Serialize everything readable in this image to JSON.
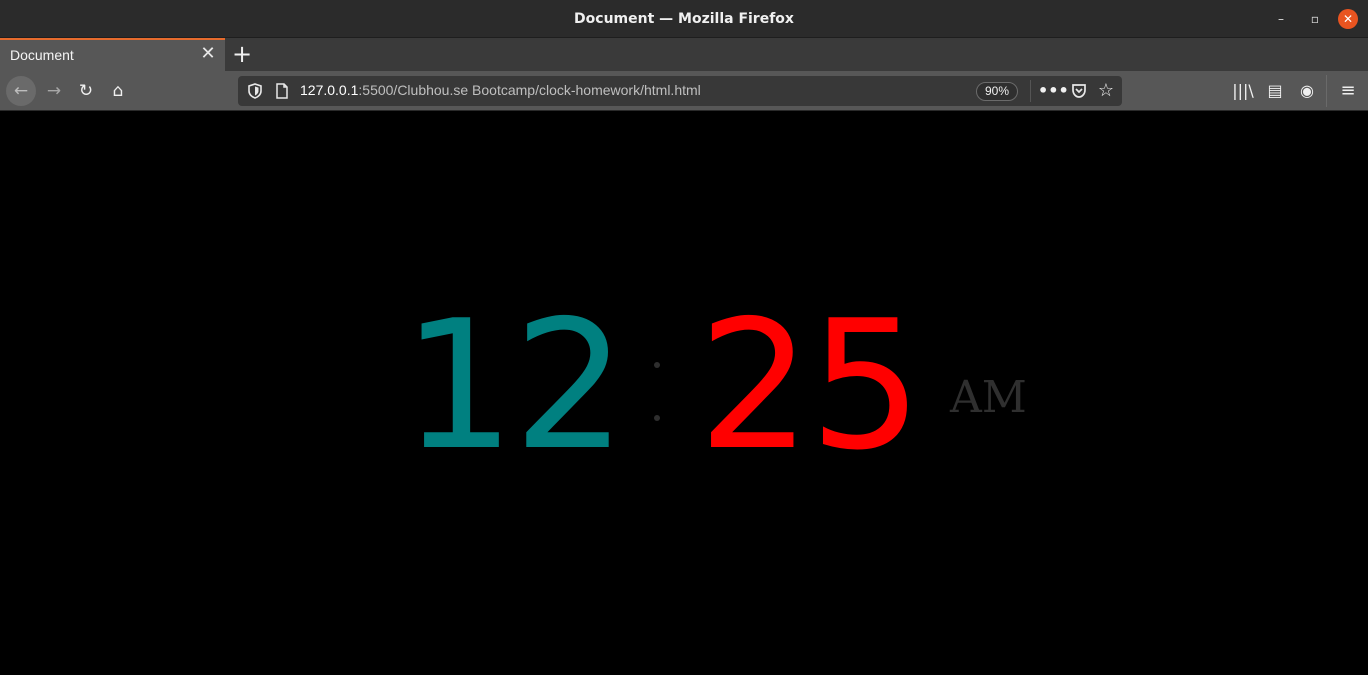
{
  "window": {
    "title": "Document — Mozilla Firefox",
    "minimize_glyph": "–",
    "maximize_glyph": "▫",
    "close_glyph": "✕"
  },
  "tabs": [
    {
      "label": "Document",
      "active": true,
      "close_glyph": "✕"
    }
  ],
  "tabstrip": {
    "new_tab_glyph": "+"
  },
  "navbar": {
    "back_glyph": "←",
    "forward_glyph": "→",
    "reload_glyph": "↻",
    "home_glyph": "⌂",
    "url_host": "127.0.0.1",
    "url_rest": ":5500/Clubhou.se Bootcamp/clock-homework/html.html",
    "zoom": "90%",
    "more_glyph": "•••",
    "pocket_glyph": "◡",
    "bookmark_glyph": "☆",
    "library_glyph": "|||\\",
    "sidebar_glyph": "▤",
    "account_glyph": "◉",
    "menu_glyph": "≡"
  },
  "clock": {
    "hours": "12",
    "minutes": "25",
    "period": "AM"
  },
  "colors": {
    "hours": "#008080",
    "minutes": "#ff0000",
    "period": "#2f2f2f",
    "accent": "#e66b2d"
  }
}
